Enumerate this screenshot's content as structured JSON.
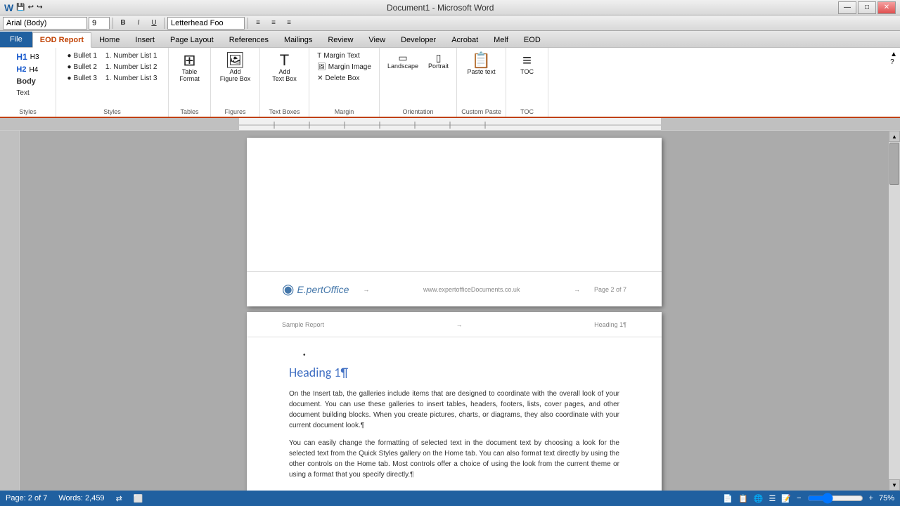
{
  "titlebar": {
    "title": "Document1 - Microsoft Word",
    "min": "—",
    "max": "□",
    "close": "✕"
  },
  "quicktoolbar": {
    "font": "Arial (Body)",
    "size": "9",
    "style": "Letterhead Foo"
  },
  "tabs": {
    "file": "File",
    "eod_report": "EOD Report",
    "home": "Home",
    "insert": "Insert",
    "page_layout": "Page Layout",
    "references": "References",
    "mailings": "Mailings",
    "review": "Review",
    "view": "View",
    "developer": "Developer",
    "acrobat": "Acrobat",
    "melf": "Melf",
    "eod": "EOD"
  },
  "ribbon": {
    "groups": {
      "styles": {
        "label": "Styles",
        "items": [
          "H1",
          "H3",
          "H2",
          "H4",
          "Body",
          "Text"
        ]
      },
      "bullets": {
        "bullet1": "Bullet 1",
        "bullet2": "Bullet 2",
        "bullet3": "Bullet 3",
        "num1": "Number List 1",
        "num2": "Number List 2",
        "num3": "Number List 3",
        "label": "Styles"
      },
      "tables": {
        "table": "Table",
        "format": "Format",
        "label": "Tables"
      },
      "figures": {
        "add_figure": "Add Figure Box",
        "label": "Figures"
      },
      "textboxes": {
        "add_text": "Add Text Box",
        "label": "Text Boxes"
      },
      "margin": {
        "margin_text": "Margin Text",
        "margin_image": "Margin Image",
        "delete_box": "Delete Box",
        "label": "Margin"
      },
      "orientation": {
        "landscape": "Landscape",
        "portrait": "Portrait",
        "label": "Orientation"
      },
      "paste": {
        "paste": "Paste text",
        "label": "Custom Paste"
      },
      "toc": {
        "toc": "TOC",
        "label": "TOC"
      }
    }
  },
  "page1": {
    "footer": {
      "logo": "E.pertOffice",
      "url": "www.expertofficeDocuments.co.uk",
      "page": "Page 2 of 7"
    }
  },
  "page2": {
    "header": {
      "left": "Sample Report",
      "center": "→",
      "right": "Heading 1¶"
    },
    "heading": "Heading 1¶",
    "para1": "On the Insert tab, the galleries include items that are designed to coordinate with the overall look of your document. You can use these galleries to insert tables, headers, footers, lists, cover pages, and other document building blocks. When you create pictures, charts, or diagrams, they also coordinate with your current document look.¶",
    "para2": "You can easily change the formatting of selected text in the document text by choosing a look for the selected text from the Quick Styles gallery on the Home tab. You can also format text directly by using the other controls on the Home tab. Most controls offer a choice of using the look from the current theme or using a format that you specify directly.¶"
  },
  "statusbar": {
    "page": "Page: 2 of 7",
    "words": "Words: 2,459",
    "zoom": "75%"
  },
  "icons": {
    "bullet": "●",
    "number": "1.",
    "table": "⊞",
    "add": "+",
    "text": "T",
    "landscape": "▭",
    "portrait": "▯",
    "paste": "📋",
    "toc": "≡",
    "arrow_right": "→",
    "minimize": "—",
    "maximize": "□",
    "close": "✕",
    "scroll_up": "▲",
    "scroll_down": "▼",
    "word_icon": "W"
  }
}
